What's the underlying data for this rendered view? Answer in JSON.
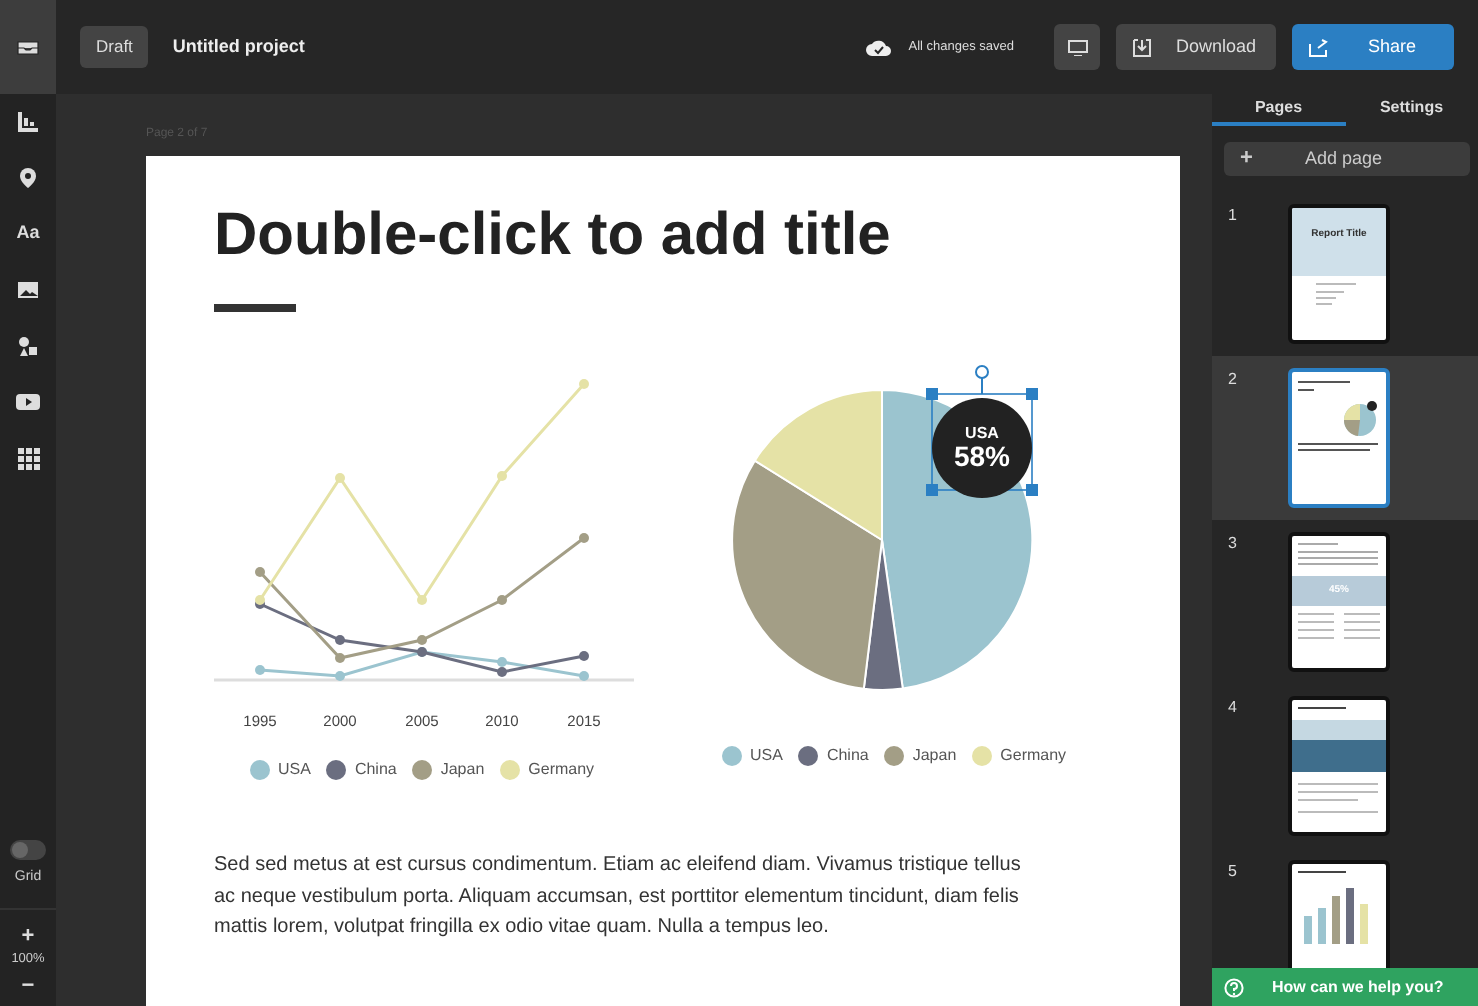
{
  "rail": {
    "items": [
      {
        "kind": "tray",
        "selected": true
      },
      {
        "kind": "chart",
        "selected": false
      },
      {
        "kind": "pin",
        "selected": false
      },
      {
        "kind": "text",
        "label": "Aa",
        "selected": false
      },
      {
        "kind": "image",
        "selected": false
      },
      {
        "kind": "shapes",
        "selected": false
      },
      {
        "kind": "video",
        "selected": false
      },
      {
        "kind": "apps",
        "selected": false
      }
    ],
    "grid": {
      "label": "Grid",
      "on": false
    },
    "zoom": {
      "plus": "+",
      "level": "100%",
      "minus": "−"
    }
  },
  "topbar": {
    "status_badge": "Draft",
    "project": "Untitled project",
    "save_status": "All changes saved",
    "buttons": [
      {
        "kind": "present"
      },
      {
        "kind": "download",
        "label": "Download"
      },
      {
        "kind": "share",
        "label": "Share"
      }
    ]
  },
  "canvas": {
    "page_label": "Page 2 of 7",
    "title": "Double-click to add title",
    "line_chart": {
      "categories": [
        "1995",
        "2000",
        "2005",
        "2010",
        "2015"
      ],
      "legend": [
        {
          "label": "USA",
          "color": "#9bc4cf"
        },
        {
          "label": "China",
          "color": "#6b6e80"
        },
        {
          "label": "Japan",
          "color": "#a39e86"
        },
        {
          "label": "Germany",
          "color": "#e5e2a6"
        }
      ]
    },
    "pie_chart": {
      "callout_label": "USA",
      "callout_value": "58%",
      "legend": [
        {
          "label": "USA",
          "color": "#9bc4cf"
        },
        {
          "label": "China",
          "color": "#6b6e80"
        },
        {
          "label": "Japan",
          "color": "#a39e86"
        },
        {
          "label": "Germany",
          "color": "#e5e2a6"
        }
      ]
    },
    "paragraph": "Sed sed metus at est cursus condimentum. Etiam ac eleifend diam. Vivamus tristique tellus ac neque vestibulum porta. Aliquam accumsan, est porttitor elementum tincidunt, diam felis mattis lorem, volutpat fringilla ex odio vitae quam. Nulla a tempus leo."
  },
  "panel": {
    "tabs": [
      {
        "label": "Pages",
        "selected": true
      },
      {
        "label": "Settings",
        "selected": false
      }
    ],
    "add_page": {
      "icon": "+",
      "label": "Add page"
    },
    "pages": [
      {
        "number": "1",
        "kind": "cover",
        "text": "Report Title",
        "selected": false
      },
      {
        "number": "2",
        "kind": "charts",
        "selected": true
      },
      {
        "number": "3",
        "kind": "stat",
        "text": "45%",
        "selected": false
      },
      {
        "number": "4",
        "kind": "photo",
        "selected": false
      },
      {
        "number": "5",
        "kind": "bars",
        "selected": false
      }
    ],
    "help": "How can we help you?"
  }
}
